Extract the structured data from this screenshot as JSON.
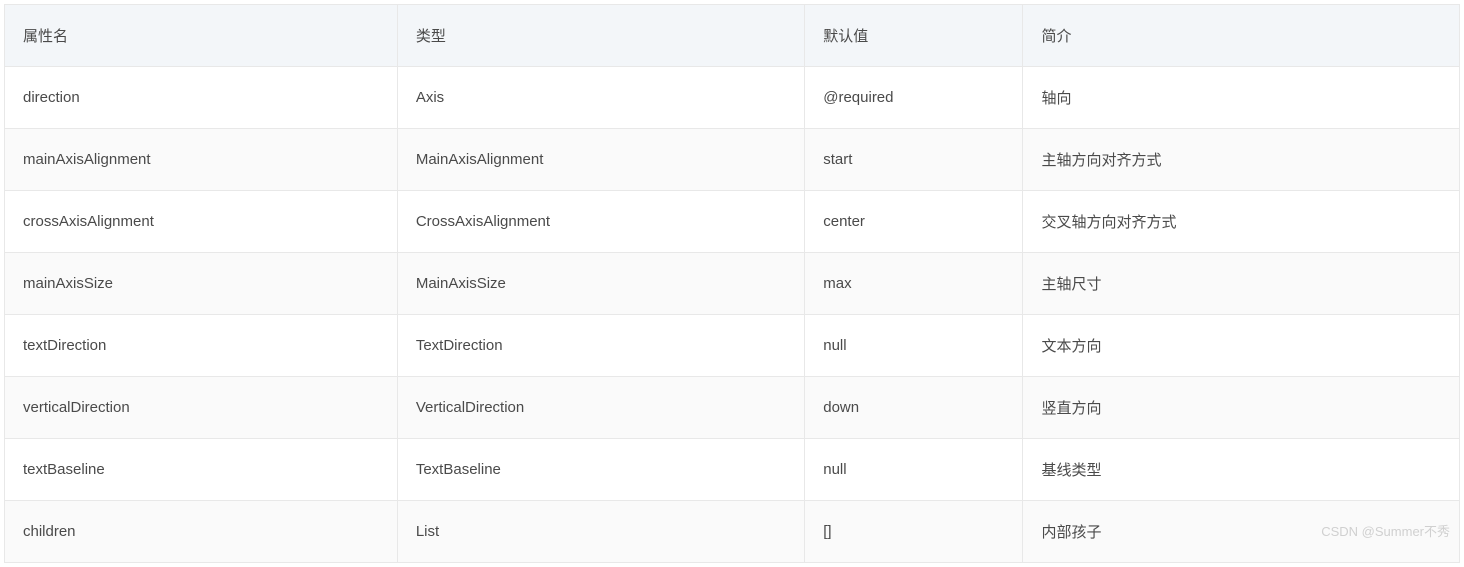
{
  "table": {
    "headers": [
      "属性名",
      "类型",
      "默认值",
      "简介"
    ],
    "rows": [
      {
        "name": "direction",
        "type": "Axis",
        "default": "@required",
        "desc": "轴向"
      },
      {
        "name": "mainAxisAlignment",
        "type": "MainAxisAlignment",
        "default": "start",
        "desc": "主轴方向对齐方式"
      },
      {
        "name": "crossAxisAlignment",
        "type": "CrossAxisAlignment",
        "default": "center",
        "desc": "交叉轴方向对齐方式"
      },
      {
        "name": "mainAxisSize",
        "type": "MainAxisSize",
        "default": "max",
        "desc": "主轴尺寸"
      },
      {
        "name": "textDirection",
        "type": "TextDirection",
        "default": "null",
        "desc": "文本方向"
      },
      {
        "name": "verticalDirection",
        "type": "VerticalDirection",
        "default": "down",
        "desc": "竖直方向"
      },
      {
        "name": "textBaseline",
        "type": "TextBaseline",
        "default": "null",
        "desc": "基线类型"
      },
      {
        "name": "children",
        "type": "List",
        "default": "[]",
        "desc": "内部孩子"
      }
    ]
  },
  "watermark": "CSDN @Summer不秀"
}
